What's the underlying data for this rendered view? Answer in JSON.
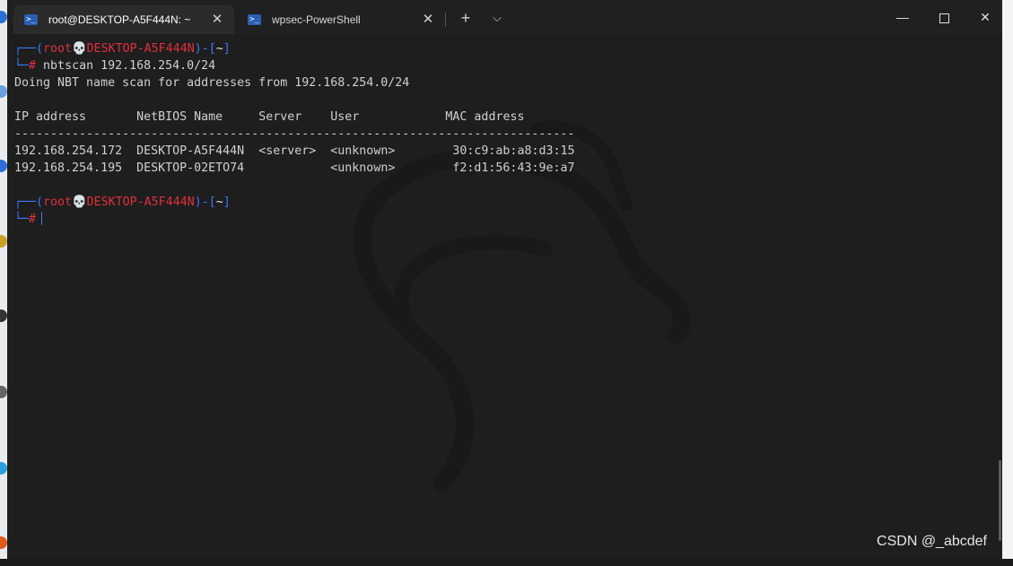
{
  "tabs": [
    {
      "title": "root@DESKTOP-A5F444N: ~",
      "active": true,
      "icon": "powershell-icon"
    },
    {
      "title": "wpsec-PowerShell",
      "active": false,
      "icon": "powershell-icon"
    }
  ],
  "tab_controls": {
    "new_tab": "+",
    "dropdown": "⌵",
    "close": "✕"
  },
  "window_controls": {
    "minimize": "—",
    "close": "✕"
  },
  "terminal": {
    "prompt1": {
      "open": "┌──(",
      "user": "root",
      "skull": "💀",
      "host": "DESKTOP-A5F444N",
      "mid": ")-[",
      "dir": "~",
      "end": "]",
      "hash_prefix": "└─",
      "hash": "#"
    },
    "command": "nbtscan 192.168.254.0/24",
    "scan_line": "Doing NBT name scan for addresses from 192.168.254.0/24",
    "columns": [
      "IP address",
      "NetBIOS Name",
      "Server",
      "User",
      "MAC address"
    ],
    "separator": "------------------------------------------------------------------------------",
    "rows": [
      {
        "ip": "192.168.254.172",
        "name": "DESKTOP-A5F444N",
        "server": "<server>",
        "user": "<unknown>",
        "mac": "30:c9:ab:a8:d3:15"
      },
      {
        "ip": "192.168.254.195",
        "name": "DESKTOP-02ETO74",
        "server": "",
        "user": "<unknown>",
        "mac": "f2:d1:56:43:9e:a7"
      }
    ]
  },
  "watermark": "CSDN @_abcdef"
}
